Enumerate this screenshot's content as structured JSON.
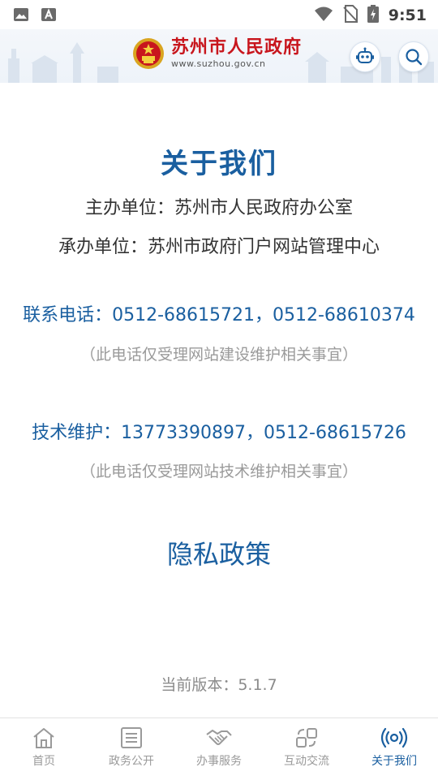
{
  "status_bar": {
    "time": "9:51"
  },
  "header": {
    "site_name": "苏州市人民政府",
    "site_url": "www.suzhou.gov.cn"
  },
  "about": {
    "title": "关于我们",
    "host": "主办单位：苏州市人民政府办公室",
    "organizer": "承办单位：苏州市政府门户网站管理中心",
    "contact_phone": "联系电话：0512-68615721，0512-68610374",
    "contact_note": "（此电话仅受理网站建设维护相关事宜）",
    "tech_support": "技术维护：13773390897，0512-68615726",
    "tech_note": "（此电话仅受理网站技术维护相关事宜）",
    "privacy_link": "隐私政策",
    "version": "当前版本：5.1.7"
  },
  "nav": [
    {
      "label": "首页",
      "icon": "home-icon",
      "active": false
    },
    {
      "label": "政务公开",
      "icon": "document-list-icon",
      "active": false
    },
    {
      "label": "办事服务",
      "icon": "handshake-icon",
      "active": false
    },
    {
      "label": "互动交流",
      "icon": "interaction-icon",
      "active": false
    },
    {
      "label": "关于我们",
      "icon": "broadcast-icon",
      "active": true
    }
  ],
  "colors": {
    "accent": "#1a5fa0",
    "brand_red": "#c8161d",
    "muted": "#9a9a9a"
  }
}
